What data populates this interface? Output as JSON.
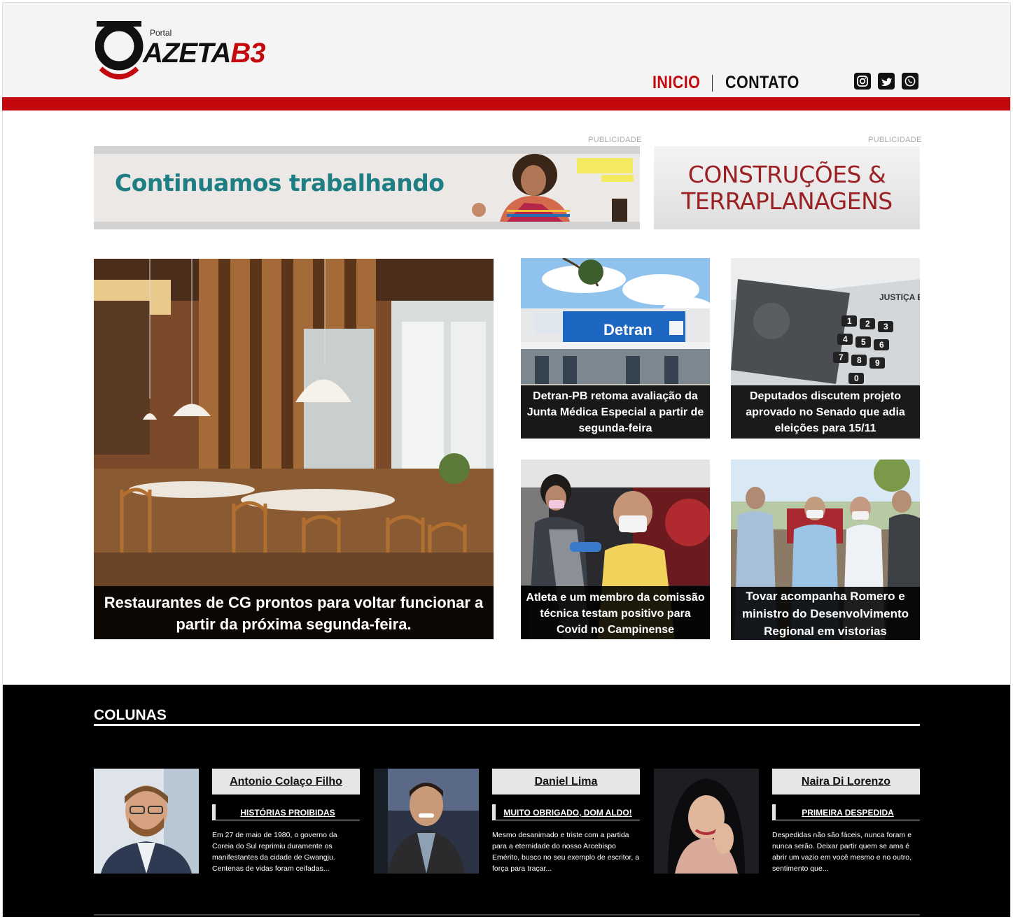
{
  "brand": {
    "logo_small": "Portal",
    "logo_main": "AZETA",
    "logo_accent": "B3",
    "primary_color": "#c4090e"
  },
  "nav": {
    "items": [
      {
        "label": "INICIO",
        "active": true
      },
      {
        "label": "CONTATO",
        "active": false
      }
    ]
  },
  "social": [
    "instagram-icon",
    "twitter-icon",
    "whatsapp-icon"
  ],
  "ads": {
    "label": "PUBLICIDADE",
    "left_text": "Continuamos trabalhando",
    "right_line1": "CONSTRUÇÕES &",
    "right_line2": "TERRAPLANAGENS"
  },
  "news": {
    "featured": "Restaurantes de CG prontos para voltar funcionar a partir da próxima segunda-feira.",
    "items": [
      "Detran-PB retoma avaliação da Junta Médica Especial a partir de segunda-feira",
      "Deputados discutem projeto aprovado no Senado que adia eleições para 15/11",
      "Atleta e um membro da comissão técnica testam positivo para Covid no Campinense",
      "Tovar acompanha Romero e ministro do Desenvolvimento Regional em vistorias"
    ],
    "image_texts": {
      "detran_sign": "Detran",
      "urna_label": "JUSTIÇA ELEITORAL",
      "keypad": [
        "1",
        "2",
        "3",
        "4",
        "5",
        "6",
        "7",
        "8",
        "9",
        "0"
      ]
    }
  },
  "colunas": {
    "title": "COLUNAS",
    "authors": [
      {
        "name": "Antonio Colaço Filho",
        "column": "HISTÓRIAS PROIBIDAS",
        "excerpt": "Em 27 de maio de 1980, o governo da Coreia do Sul reprimiu duramente os manifestantes da cidade de Gwangju. Centenas de vidas foram ceifadas..."
      },
      {
        "name": "Daniel Lima",
        "column": "MUITO OBRIGADO, DOM ALDO!",
        "excerpt": "Mesmo desanimado e triste com a partida para a eternidade do nosso Arcebispo Emérito, busco no seu exemplo de escritor, a força para traçar..."
      },
      {
        "name": "Naira Di Lorenzo",
        "column": "PRIMEIRA DESPEDIDA",
        "excerpt": "Despedidas não são fáceis, nunca foram e nunca serão. Deixar partir quem se ama é abrir um vazio em você mesmo e no outro, sentimento que..."
      }
    ]
  }
}
